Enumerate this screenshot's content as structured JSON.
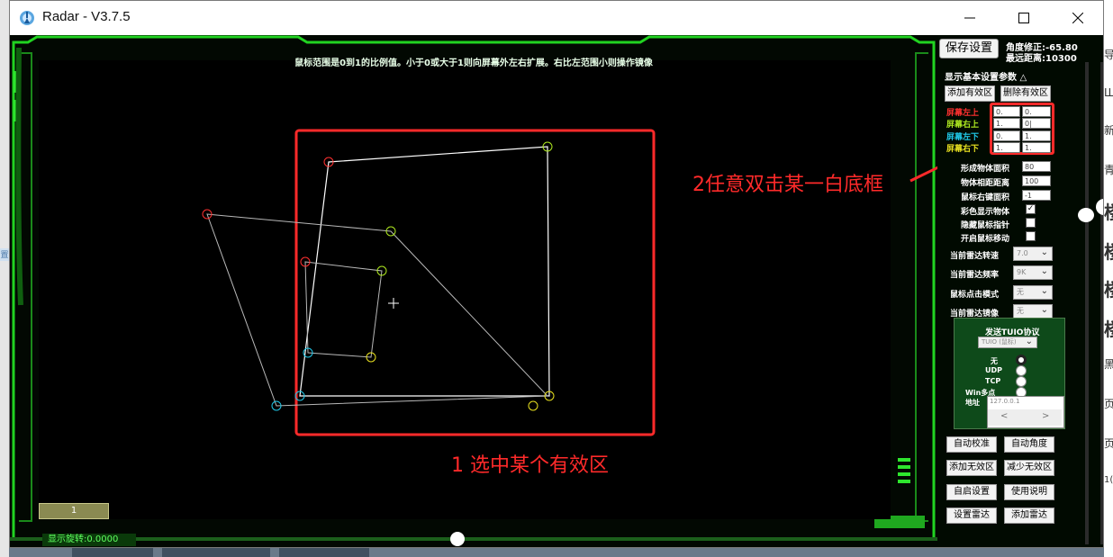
{
  "window": {
    "title": "Radar - V3.7.5",
    "controls": {
      "minimize": "minimize-icon",
      "maximize": "maximize-icon",
      "close": "close-icon"
    }
  },
  "radar": {
    "hint": "鼠标范围是0到1的比例值。小于0或大于1则向屏幕外左右扩展。右比左范围小则操作镜像",
    "page": "1",
    "rotation": "显示旋转:0.0000",
    "annotation_1": "1 选中某个有效区",
    "annotation_2": "2任意双击某一白底框",
    "colors": {
      "accent_green": "#21d321",
      "annotation_red": "#ff2a2a",
      "zone_white": "#ffffff",
      "marker_red": "#ff3030",
      "marker_green": "#aee820",
      "marker_cyan": "#20c8e8",
      "marker_yellow": "#e8e020"
    }
  },
  "panel": {
    "save_button": "保存设置",
    "angle_correction": "角度修正:-65.80",
    "max_distance": "最远距离:10300",
    "section_title": "显示基本设置参数 △",
    "add_zone": "添加有效区",
    "delete_zone": "删除有效区",
    "screen_top_left": {
      "label": "屏幕左上",
      "x": "0.",
      "y": "0."
    },
    "screen_top_right": {
      "label": "屏幕右上",
      "x": "1.",
      "y": "0|"
    },
    "screen_bottom_left": {
      "label": "屏幕左下",
      "x": "0.",
      "y": "1."
    },
    "screen_bottom_right": {
      "label": "屏幕右下",
      "x": "1.",
      "y": "1."
    },
    "object_area": {
      "label": "形成物体面积",
      "value": "80"
    },
    "object_distance": {
      "label": "物体相距距离",
      "value": "100"
    },
    "mouse_right_area": {
      "label": "鼠标右键面积",
      "value": "-1"
    },
    "color_display": {
      "label": "彩色显示物体",
      "checked": "✓"
    },
    "hide_pointer": {
      "label": "隐藏鼠标指针"
    },
    "enable_mouse_move": {
      "label": "开启鼠标移动"
    },
    "radar_speed": {
      "label": "当前雷达转速",
      "value": "7.0"
    },
    "radar_freq": {
      "label": "当前雷达频率",
      "value": "9K"
    },
    "click_mode": {
      "label": "鼠标点击模式",
      "value": "无"
    },
    "radar_mirror": {
      "label": "当前雷达镜像",
      "value": "无"
    },
    "tuio": {
      "title": "发送TUIO协议",
      "select": "TUIO (鼠标)",
      "options": [
        "无",
        "UDP",
        "TCP",
        "Win多点"
      ],
      "address_label": "地址",
      "address_value": "127.0.0.1"
    },
    "auto_calibrate": "自动校准",
    "auto_angle": "自动角度",
    "add_invalid": "添加无效区",
    "reduce_invalid": "减少无效区",
    "autostart": "自启设置",
    "manual": "使用说明",
    "set_radar": "设置雷达",
    "add_radar": "添加雷达"
  },
  "desktop": {
    "left_tab": "置",
    "right_chars": [
      "导",
      "Ш",
      "新",
      "青",
      "楼",
      "楼",
      "楼",
      "楼",
      "黑",
      "页",
      "页",
      "1("
    ]
  }
}
